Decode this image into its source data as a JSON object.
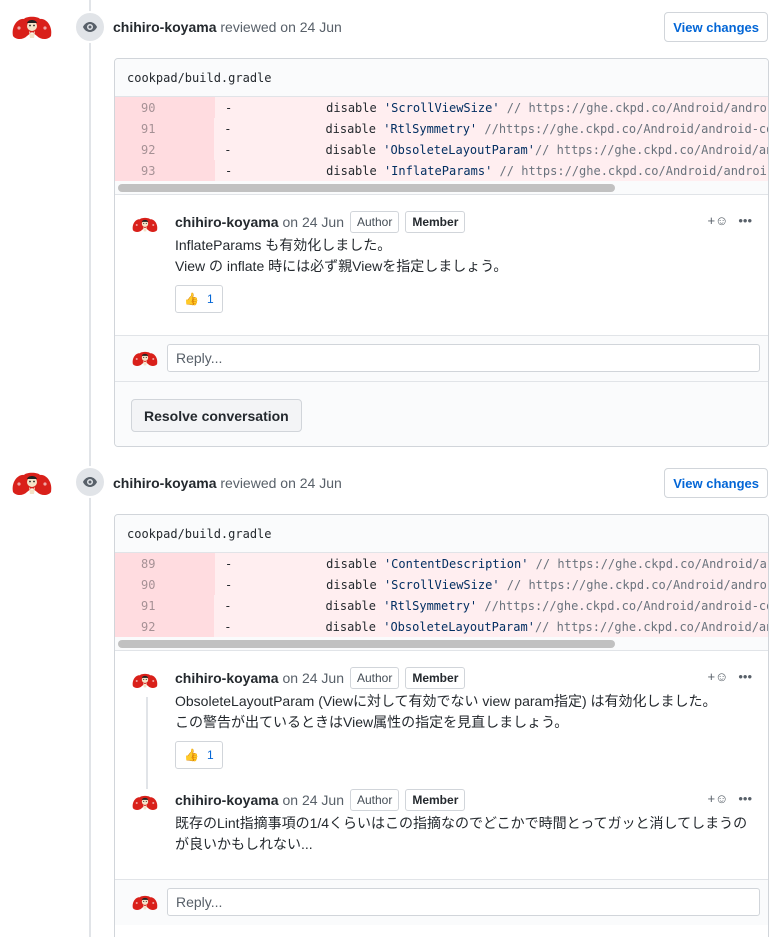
{
  "colors": {
    "link": "#0366d6",
    "diff_removed_bg": "#ffeef0",
    "diff_gutter_bg": "#ffdce0",
    "avatar_red": "#d9201a"
  },
  "reviews": [
    {
      "author": "chihiro-koyama",
      "action_text": "reviewed on 24 Jun",
      "view_changes": "View changes",
      "file": "cookpad/build.gradle",
      "diff": [
        {
          "num": "90",
          "sign": "-",
          "kw": "disable ",
          "str": "'ScrollViewSize'",
          "cmt": " // https://ghe.ckpd.co/Android/andro"
        },
        {
          "num": "91",
          "sign": "-",
          "kw": "disable ",
          "str": "'RtlSymmetry'",
          "cmt": " //https://ghe.ckpd.co/Android/android-co"
        },
        {
          "num": "92",
          "sign": "-",
          "kw": "disable ",
          "str": "'ObsoleteLayoutParam'",
          "cmt": "// https://ghe.ckpd.co/Android/an"
        },
        {
          "num": "93",
          "sign": "-",
          "kw": "disable ",
          "str": "'InflateParams'",
          "cmt": " // https://ghe.ckpd.co/Android/androi"
        }
      ],
      "comments": [
        {
          "author": "chihiro-koyama",
          "date": "on 24 Jun",
          "badge_author": "Author",
          "badge_member": "Member",
          "body_line1": "InflateParams も有効化しました。",
          "body_line2": "View の inflate 時には必ず親Viewを指定しましょう。",
          "reaction_emoji": "👍",
          "reaction_count": "1"
        }
      ],
      "reply_placeholder": "Reply...",
      "resolve_label": "Resolve conversation"
    },
    {
      "author": "chihiro-koyama",
      "action_text": "reviewed on 24 Jun",
      "view_changes": "View changes",
      "file": "cookpad/build.gradle",
      "diff": [
        {
          "num": "89",
          "sign": "-",
          "kw": "disable ",
          "str": "'ContentDescription'",
          "cmt": " // https://ghe.ckpd.co/Android/a"
        },
        {
          "num": "90",
          "sign": "-",
          "kw": "disable ",
          "str": "'ScrollViewSize'",
          "cmt": " // https://ghe.ckpd.co/Android/andro"
        },
        {
          "num": "91",
          "sign": "-",
          "kw": "disable ",
          "str": "'RtlSymmetry'",
          "cmt": " //https://ghe.ckpd.co/Android/android-co"
        },
        {
          "num": "92",
          "sign": "-",
          "kw": "disable ",
          "str": "'ObsoleteLayoutParam'",
          "cmt": "// https://ghe.ckpd.co/Android/an"
        }
      ],
      "comments": [
        {
          "author": "chihiro-koyama",
          "date": "on 24 Jun",
          "badge_author": "Author",
          "badge_member": "Member",
          "body_line1": "ObsoleteLayoutParam (Viewに対して有効でない view param指定) は有効化しました。",
          "body_line2": "この警告が出ているときはView属性の指定を見直しましょう。",
          "reaction_emoji": "👍",
          "reaction_count": "1"
        },
        {
          "author": "chihiro-koyama",
          "date": "on 24 Jun",
          "badge_author": "Author",
          "badge_member": "Member",
          "body_line1": "既存のLint指摘事項の1/4くらいはこの指摘なのでどこかで時間とってガッと消してしまうの",
          "body_line2": "が良いかもしれない..."
        }
      ],
      "reply_placeholder": "Reply..."
    }
  ],
  "icons": {
    "eye": "eye-icon",
    "emoji": "add-reaction-icon",
    "more": "kebab-icon",
    "avatar": "red-kimono-avatar"
  }
}
